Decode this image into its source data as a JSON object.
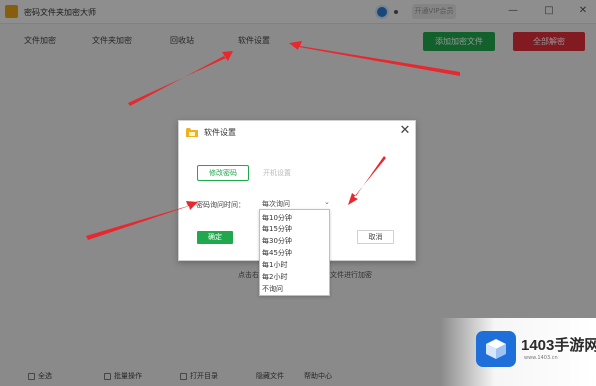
{
  "app": {
    "title": "密码文件夹加密大师",
    "vip_label": "开通VIP会员",
    "win_min": "—",
    "win_max": "□",
    "win_close": "✕"
  },
  "toolbar": {
    "tabs": [
      "文件加密",
      "文件夹加密",
      "回收站",
      "软件设置"
    ],
    "green_button": "添加加密文件",
    "red_button": "全部解密"
  },
  "hint": {
    "left": "点击右上角",
    "right": "文件进行加密"
  },
  "bottom": {
    "items": [
      "全选",
      "批量操作",
      "打开目录",
      "隐藏文件",
      "帮助中心"
    ]
  },
  "dialog": {
    "title": "软件设置",
    "close": "✕",
    "tab_active": "修改密码",
    "tab_inactive": "开机设置",
    "field_label": "密码询问时间：",
    "select_value": "每次询问",
    "confirm": "确定",
    "cancel": "取消"
  },
  "dropdown": {
    "options": [
      "每10分钟",
      "每15分钟",
      "每30分钟",
      "每45分钟",
      "每1小时",
      "每2小时",
      "不询问"
    ]
  },
  "watermark": {
    "text": "1403手游网",
    "url": "www.1403.cn"
  },
  "colors": {
    "accent_green": "#1fa84d",
    "accent_red": "#e02d3c",
    "arrow_red": "#e8282e",
    "watermark_blue": "#1e6fd9"
  }
}
